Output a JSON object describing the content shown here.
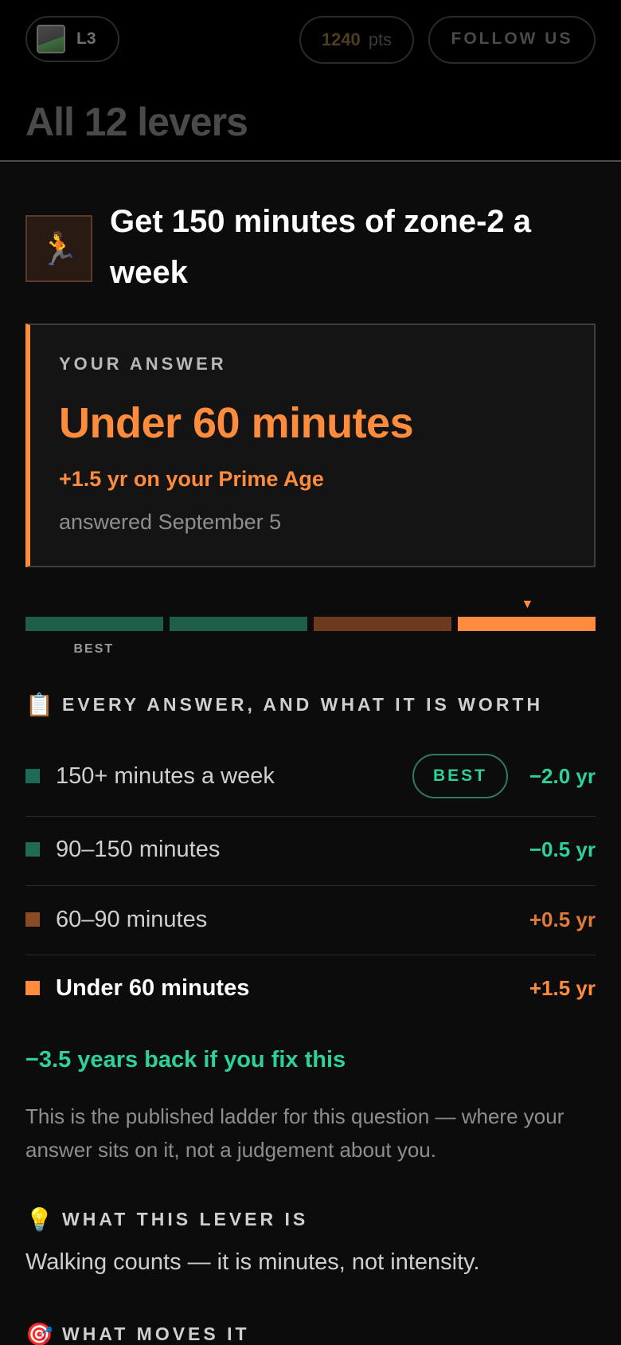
{
  "header": {
    "level_label": "L3",
    "points_value": "1240",
    "points_unit": "pts",
    "follow_label": "FOLLOW US",
    "page_title": "All 12 levers"
  },
  "lever": {
    "icon": "runner-icon",
    "icon_glyph": "🏃",
    "title": "Get 150 minutes of zone-2 a week"
  },
  "answer": {
    "kicker": "YOUR ANSWER",
    "value": "Under 60 minutes",
    "impact": "+1.5 yr on your Prime Age",
    "date": "answered September 5"
  },
  "ladder": {
    "best_label": "BEST",
    "selected_index": 3,
    "segments": [
      {
        "color": "#1f5e4a"
      },
      {
        "color": "#1f5e4a"
      },
      {
        "color": "#6b3a1f"
      },
      {
        "color": "#ff8c3d"
      }
    ]
  },
  "options_section": {
    "emoji": "📋",
    "label": "EVERY ANSWER, AND WHAT IT IS WORTH",
    "best_badge": "BEST",
    "options": [
      {
        "label": "150+ minutes a week",
        "value": "−2.0 yr",
        "square_color": "#1f6b55",
        "value_color": "#2ed197",
        "best": true,
        "selected": false
      },
      {
        "label": "90–150 minutes",
        "value": "−0.5 yr",
        "square_color": "#1f6b55",
        "value_color": "#2ed197",
        "best": false,
        "selected": false
      },
      {
        "label": "60–90 minutes",
        "value": "+0.5 yr",
        "square_color": "#8a4a26",
        "value_color": "#e07a3a",
        "best": false,
        "selected": false
      },
      {
        "label": "Under 60 minutes",
        "value": "+1.5 yr",
        "square_color": "#ff8c3d",
        "value_color": "#ff8c3d",
        "best": false,
        "selected": true
      }
    ]
  },
  "fix_line": "−3.5 years back if you fix this",
  "ladder_note": "This is the published ladder for this question — where your answer sits on it, not a judgement about you.",
  "what_lever_is": {
    "emoji": "💡",
    "label": "WHAT THIS LEVER IS",
    "body": "Walking counts — it is minutes, not intensity."
  },
  "what_moves_it": {
    "emoji": "🎯",
    "label": "WHAT MOVES IT"
  },
  "colors": {
    "accent_orange": "#ff8c3d",
    "accent_green": "#2ed197"
  }
}
